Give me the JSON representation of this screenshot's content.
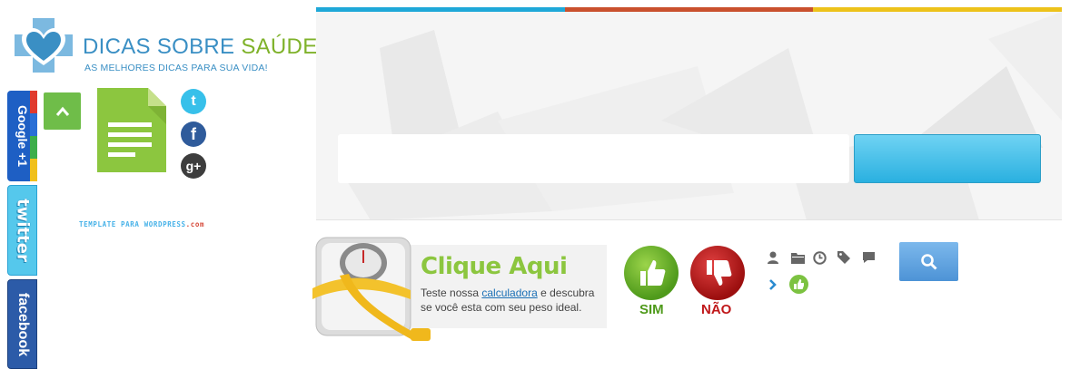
{
  "logo": {
    "title_main": "DICAS SOBRE ",
    "title_accent": "SAÚDE",
    "tagline": "AS MELHORES DICAS PARA SUA VIDA!"
  },
  "social_tabs": {
    "googleplus": "Google +1",
    "twitter": "twitter",
    "facebook": "facebook"
  },
  "social_icons": {
    "twitter": "t",
    "facebook": "f",
    "googleplus": "g+"
  },
  "credit": {
    "part1": "TEMPLATE PARA WORDPRESS",
    "part2": ".com"
  },
  "banner": {
    "bar_colors": [
      "#1fa8d8",
      "#c9502d",
      "#edc21a"
    ]
  },
  "promo": {
    "title": "Clique Aqui",
    "text_before": "Teste nossa ",
    "link": "calculadora",
    "text_after": " e descubra se você esta com seu peso ideal."
  },
  "vote": {
    "yes": "SIM",
    "no": "NÃO"
  },
  "icons": [
    "user-icon",
    "folder-icon",
    "clock-icon",
    "tag-icon",
    "comment-icon",
    "chevron-right-icon",
    "thumbs-up-icon",
    "search-icon"
  ],
  "colors": {
    "brand_blue": "#3a8fc4",
    "brand_green": "#7fb22a",
    "promo_green": "#8cc63f"
  }
}
